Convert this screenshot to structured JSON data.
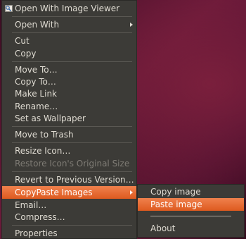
{
  "context_menu": {
    "items": [
      {
        "label": "Open With Image Viewer"
      },
      {
        "label": "Open With"
      },
      {
        "label": "Cut"
      },
      {
        "label": "Copy"
      },
      {
        "label": "Move To…"
      },
      {
        "label": "Copy To…"
      },
      {
        "label": "Make Link"
      },
      {
        "label": "Rename…"
      },
      {
        "label": "Set as Wallpaper"
      },
      {
        "label": "Move to Trash"
      },
      {
        "label": "Resize Icon…"
      },
      {
        "label": "Restore Icon's Original Size"
      },
      {
        "label": "Revert to Previous Version…"
      },
      {
        "label": "CopyPaste Images"
      },
      {
        "label": "Email…"
      },
      {
        "label": "Compress…"
      },
      {
        "label": "Properties"
      }
    ]
  },
  "submenu": {
    "items": [
      {
        "label": "Copy image"
      },
      {
        "label": "Paste image"
      },
      {
        "label": "About"
      }
    ]
  },
  "colors": {
    "highlight": "#e8692f",
    "menu_background": "#3c3b37",
    "text": "#dfdbd2",
    "disabled_text": "#7f7c75"
  }
}
